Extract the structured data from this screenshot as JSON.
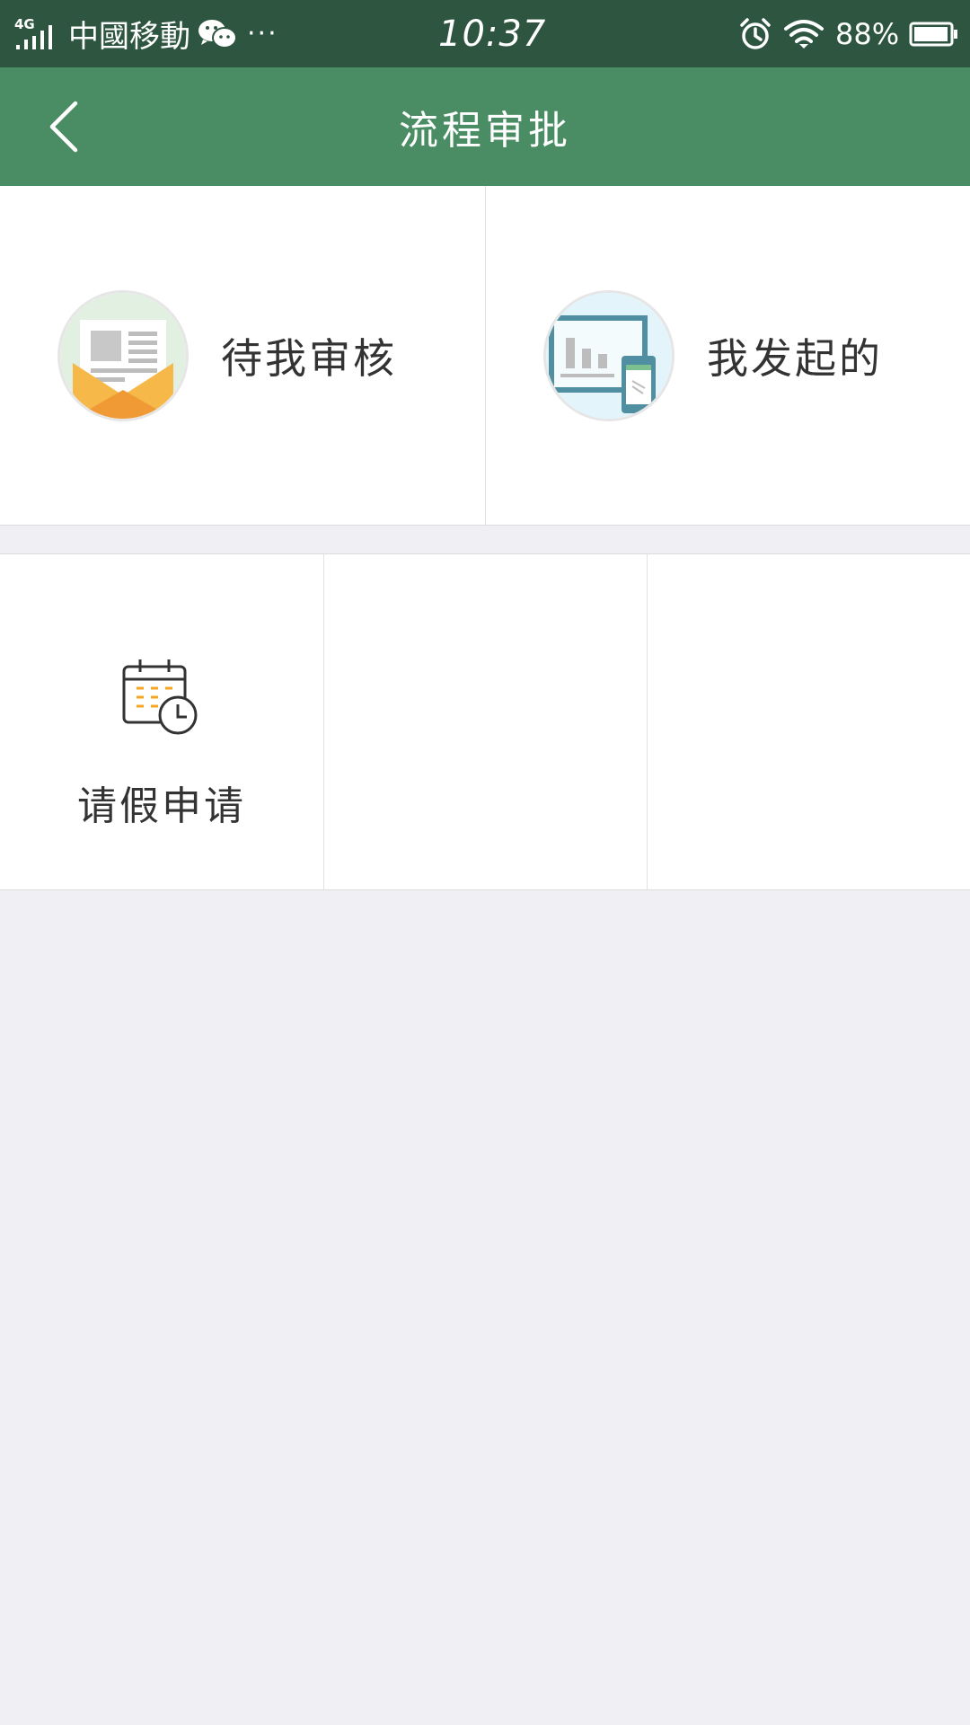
{
  "status_bar": {
    "network": "4G",
    "carrier": "中國移動",
    "more": "···",
    "time": "10:37",
    "battery": "88%",
    "battery_level": 0.88
  },
  "header": {
    "title": "流程审批",
    "back_icon": "chevron-left-icon"
  },
  "top_menu": [
    {
      "label": "待我审核",
      "icon": "inbox-envelope-icon"
    },
    {
      "label": "我发起的",
      "icon": "dashboard-device-icon"
    }
  ],
  "grid_menu": [
    {
      "label": "请假申请",
      "icon": "calendar-clock-icon"
    }
  ],
  "colors": {
    "status_bar_bg": "#2e5540",
    "header_bg": "#4a8c63",
    "page_bg": "#efeff4",
    "accent_orange": "#f5a623"
  }
}
